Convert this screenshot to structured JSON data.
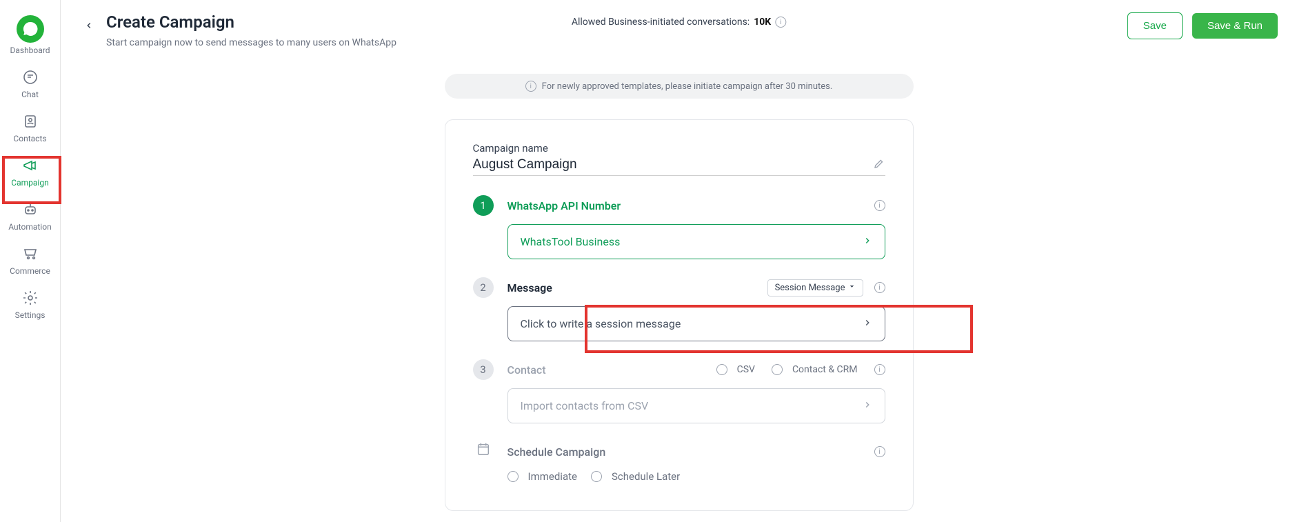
{
  "sidebar": {
    "items": [
      {
        "label": "Dashboard"
      },
      {
        "label": "Chat"
      },
      {
        "label": "Contacts"
      },
      {
        "label": "Campaign"
      },
      {
        "label": "Automation"
      },
      {
        "label": "Commerce"
      },
      {
        "label": "Settings"
      }
    ]
  },
  "header": {
    "title": "Create Campaign",
    "subtitle": "Start campaign now to send messages to many users on WhatsApp",
    "allowed_prefix": "Allowed Business-initiated conversations: ",
    "allowed_value": "10K",
    "save_label": "Save",
    "save_run_label": "Save & Run"
  },
  "notice": {
    "text": "For newly approved templates, please initiate campaign after 30 minutes."
  },
  "form": {
    "campaign_name_label": "Campaign name",
    "campaign_name_value": "August Campaign",
    "steps": {
      "api": {
        "num": "1",
        "title": "WhatsApp API Number",
        "selected": "WhatsTool Business"
      },
      "message": {
        "num": "2",
        "title": "Message",
        "type_selected": "Session Message",
        "placeholder": "Click to write a session message"
      },
      "contact": {
        "num": "3",
        "title": "Contact",
        "csv_label": "CSV",
        "crm_label": "Contact & CRM",
        "import_label": "Import contacts from CSV"
      },
      "schedule": {
        "title": "Schedule Campaign",
        "immediate_label": "Immediate",
        "later_label": "Schedule Later"
      }
    }
  }
}
